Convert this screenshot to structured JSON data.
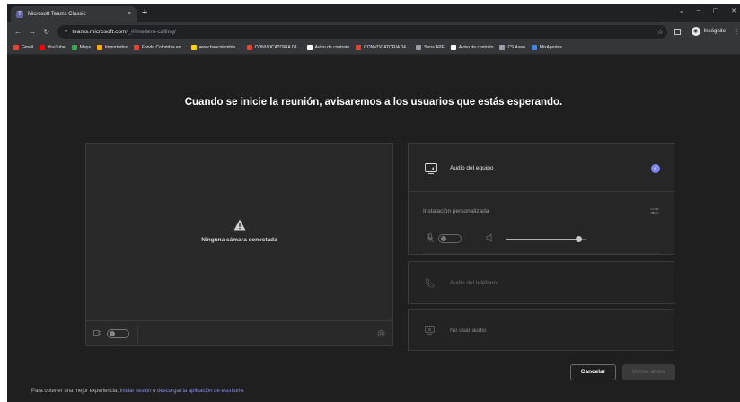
{
  "browser": {
    "tab_title": "Microsoft Teams Classic",
    "tab_close": "×",
    "new_tab": "+",
    "window_controls": [
      "⌄",
      "–",
      "▢",
      "✕"
    ],
    "url_host": "teams.microsoft.com",
    "url_path": "/_#/modern-calling/",
    "incognito_label": "Incógnito",
    "icons": {
      "back": "back-arrow-icon",
      "forward": "forward-arrow-icon",
      "reload": "reload-icon",
      "lock": "lock-icon",
      "star": "star-icon",
      "side_panel": "side-panel-icon",
      "menu": "menu-dots-icon"
    }
  },
  "bookmarks": [
    {
      "label": "Gmail",
      "color": "#ea4335"
    },
    {
      "label": "YouTube",
      "color": "#ff0000"
    },
    {
      "label": "Maps",
      "color": "#34a853"
    },
    {
      "label": "Importados",
      "color": "#f9ab00"
    },
    {
      "label": "Fondo Colombia en...",
      "color": "#e94235"
    },
    {
      "label": "www.bancolombia....",
      "color": "#ffd200"
    },
    {
      "label": "CONVOCATORIA 03...",
      "color": "#e94235"
    },
    {
      "label": "Aviso de contrato",
      "color": "#ffffff"
    },
    {
      "label": "CONVOCATORIA 04...",
      "color": "#e94235"
    },
    {
      "label": "Sena APE",
      "color": "#9aa0a6"
    },
    {
      "label": "Aviso de contrato",
      "color": "#ffffff"
    },
    {
      "label": "CS Aseo",
      "color": "#9aa0a6"
    },
    {
      "label": "MisAportes",
      "color": "#4285f4"
    }
  ],
  "prejoin": {
    "heading": "Cuando se inicie la reunión, avisaremos a los usuarios que estás esperando.",
    "camera": {
      "status_text": "Ninguna cámara conectada",
      "camera_on": false
    },
    "audio": {
      "computer_audio_label": "Audio del equipo",
      "computer_audio_selected": true,
      "custom_setup_label": "Instalación personalizada",
      "mic_on": false,
      "volume_fraction": 0.9,
      "phone_audio_label": "Audio del teléfono",
      "no_audio_label": "No usar audio"
    },
    "buttons": {
      "cancel": "Cancelar",
      "join": "Unirse ahora"
    },
    "footer": {
      "prefix": "Para obtener una mejor experiencia, ",
      "link_signin": "iniciar sesión",
      "middle": " o ",
      "link_download": "descargar la aplicación de escritorio",
      "suffix": "."
    },
    "colors": {
      "accent": "#7f85f5",
      "background": "#1f1f1f",
      "panel": "#292929"
    }
  }
}
